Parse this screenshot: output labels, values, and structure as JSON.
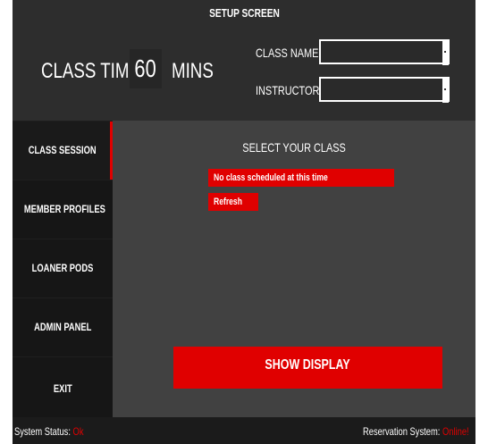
{
  "header": {
    "title": "SETUP SCREEN",
    "class_time_label": "CLASS TIME:",
    "class_time_value": "60",
    "class_time_unit": "MINS",
    "class_name_label": "CLASS NAME:",
    "class_name_value": "",
    "instructor_label": "INSTRUCTOR:",
    "instructor_value": ""
  },
  "sidebar": {
    "items": [
      {
        "label": "CLASS SESSION",
        "active": true
      },
      {
        "label": "MEMBER PROFILES",
        "active": false
      },
      {
        "label": "LOANER PODS",
        "active": false
      },
      {
        "label": "ADMIN PANEL",
        "active": false
      },
      {
        "label": "EXIT",
        "active": false
      }
    ]
  },
  "main": {
    "select_title": "SELECT YOUR CLASS",
    "no_class_message": "No class scheduled at this time",
    "refresh_label": "Refresh",
    "show_display_label": "SHOW DISPLAY"
  },
  "footer": {
    "system_status_label": "System Status:",
    "system_status_value": "Ok",
    "reservation_label": "Reservation System:",
    "reservation_value": "Online!"
  },
  "colors": {
    "accent": "#e00000",
    "background": "#2a2a2a",
    "sidebar": "#161616",
    "main": "#414141"
  }
}
